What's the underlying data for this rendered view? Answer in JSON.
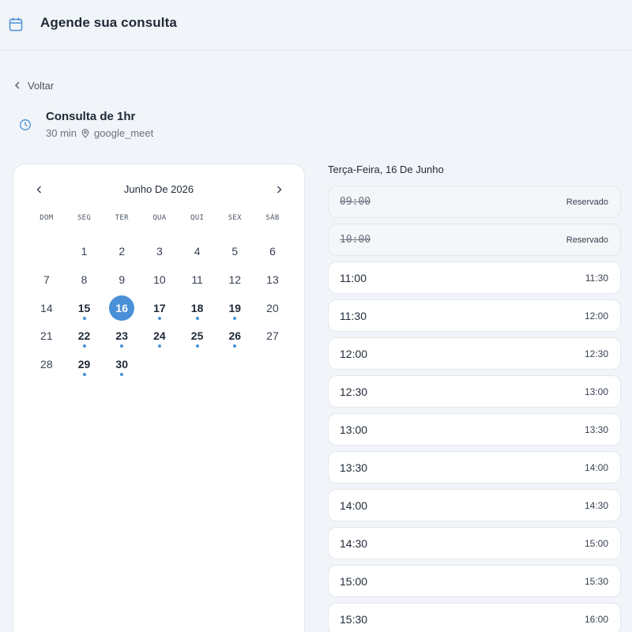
{
  "header": {
    "title": "Agende sua consulta",
    "icon": "calendar-icon"
  },
  "back": {
    "label": "Voltar"
  },
  "event": {
    "name": "Consulta de 1hr",
    "duration": "30 min",
    "location": "google_meet"
  },
  "calendar": {
    "month": "Junho De 2026",
    "weekdays": [
      "DOM",
      "SEG",
      "TER",
      "QUA",
      "QUI",
      "SEX",
      "SÁB"
    ],
    "weeks": [
      [
        null,
        {
          "d": "1"
        },
        {
          "d": "2"
        },
        {
          "d": "3"
        },
        {
          "d": "4"
        },
        {
          "d": "5"
        },
        {
          "d": "6"
        }
      ],
      [
        {
          "d": "7"
        },
        {
          "d": "8"
        },
        {
          "d": "9"
        },
        {
          "d": "10"
        },
        {
          "d": "11"
        },
        {
          "d": "12"
        },
        {
          "d": "13"
        }
      ],
      [
        {
          "d": "14"
        },
        {
          "d": "15",
          "available": true
        },
        {
          "d": "16",
          "available": true,
          "selected": true
        },
        {
          "d": "17",
          "available": true
        },
        {
          "d": "18",
          "available": true
        },
        {
          "d": "19",
          "available": true
        },
        {
          "d": "20"
        }
      ],
      [
        {
          "d": "21"
        },
        {
          "d": "22",
          "available": true
        },
        {
          "d": "23",
          "available": true
        },
        {
          "d": "24",
          "available": true
        },
        {
          "d": "25",
          "available": true
        },
        {
          "d": "26",
          "available": true
        },
        {
          "d": "27"
        }
      ],
      [
        {
          "d": "28"
        },
        {
          "d": "29",
          "available": true
        },
        {
          "d": "30",
          "available": true
        },
        null,
        null,
        null,
        null
      ]
    ],
    "accent_color": "#4a90d9"
  },
  "slots": {
    "title": "Terça-Feira, 16 De Junho",
    "items": [
      {
        "start": "09:00",
        "end": "Reservado",
        "booked": true
      },
      {
        "start": "10:00",
        "end": "Reservado",
        "booked": true
      },
      {
        "start": "11:00",
        "end": "11:30",
        "booked": false
      },
      {
        "start": "11:30",
        "end": "12:00",
        "booked": false
      },
      {
        "start": "12:00",
        "end": "12:30",
        "booked": false
      },
      {
        "start": "12:30",
        "end": "13:00",
        "booked": false
      },
      {
        "start": "13:00",
        "end": "13:30",
        "booked": false
      },
      {
        "start": "13:30",
        "end": "14:00",
        "booked": false
      },
      {
        "start": "14:00",
        "end": "14:30",
        "booked": false
      },
      {
        "start": "14:30",
        "end": "15:00",
        "booked": false
      },
      {
        "start": "15:00",
        "end": "15:30",
        "booked": false
      },
      {
        "start": "15:30",
        "end": "16:00",
        "booked": false
      }
    ]
  }
}
